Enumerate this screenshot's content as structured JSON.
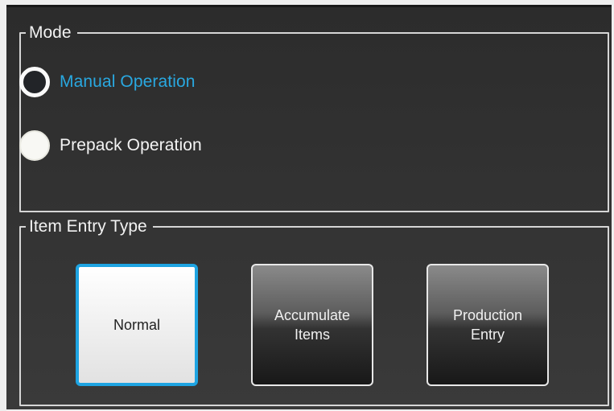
{
  "mode": {
    "legend": "Mode",
    "options": [
      {
        "label": "Manual Operation",
        "selected": true
      },
      {
        "label": "Prepack Operation",
        "selected": false
      }
    ]
  },
  "item_entry": {
    "legend": "Item Entry Type",
    "buttons": [
      {
        "label": "Normal",
        "selected": true
      },
      {
        "label": "Accumulate\nItems",
        "selected": false
      },
      {
        "label": "Production\nEntry",
        "selected": false
      }
    ]
  },
  "colors": {
    "accent": "#1ea4e2",
    "selected_text": "#29a8e0",
    "background": "#2c2c2c"
  }
}
